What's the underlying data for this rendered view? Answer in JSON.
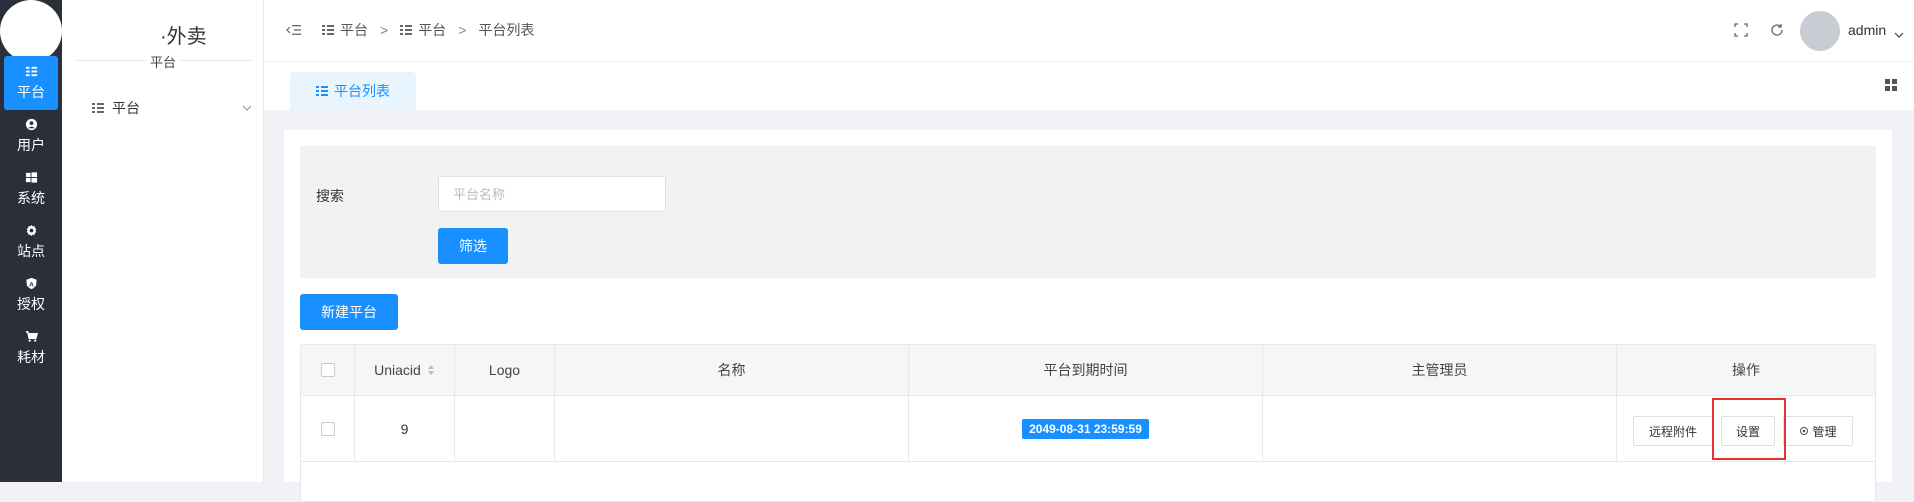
{
  "nav": {
    "items": [
      {
        "label": "平台",
        "icon": "list-icon"
      },
      {
        "label": "用户",
        "icon": "user-icon"
      },
      {
        "label": "系统",
        "icon": "windows-icon"
      },
      {
        "label": "站点",
        "icon": "gear-icon"
      },
      {
        "label": "授权",
        "icon": "shield-icon"
      },
      {
        "label": "耗材",
        "icon": "cart-icon"
      }
    ]
  },
  "sidebar": {
    "brand_title": "·外卖",
    "brand_subtitle": "平台",
    "menu_item": "平台"
  },
  "header": {
    "breadcrumb": [
      "平台",
      "平台",
      "平台列表"
    ],
    "separator": ">",
    "username": "admin"
  },
  "tabs": [
    {
      "label": "平台列表"
    }
  ],
  "filter": {
    "label": "搜索",
    "placeholder": "平台名称",
    "filter_button": "筛选"
  },
  "new_button": "新建平台",
  "table": {
    "columns": [
      "Uniacid",
      "Logo",
      "名称",
      "平台到期时间",
      "主管理员",
      "操作"
    ],
    "rows": [
      {
        "uniacid": "9",
        "logo": "",
        "name": "",
        "expire": "2049-08-31 23:59:59",
        "admin": "",
        "actions": [
          "远程附件",
          "设置",
          "管理"
        ]
      }
    ]
  },
  "colors": {
    "primary": "#1890ff",
    "nav_bg": "#2b2f3a",
    "highlight": "#e8312f"
  }
}
